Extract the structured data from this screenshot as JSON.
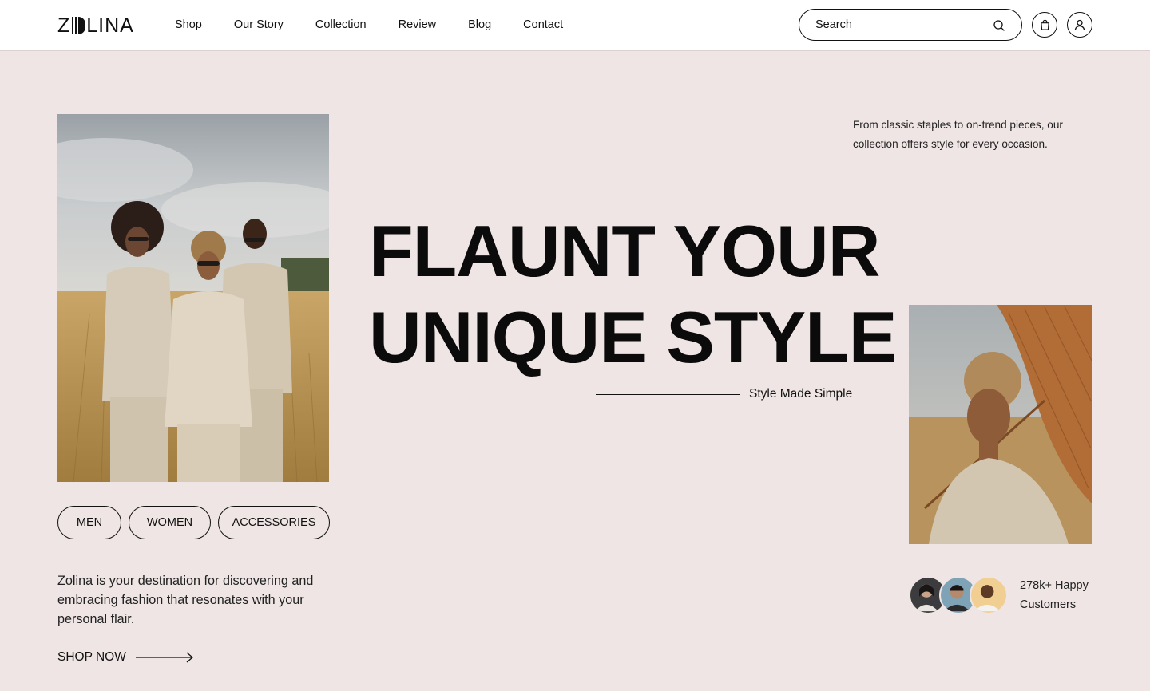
{
  "brand": {
    "logo": "ZOLINA",
    "logo_prefix": "Z",
    "logo_suffix": "LINA"
  },
  "nav": {
    "items": [
      "Shop",
      "Our Story",
      "Collection",
      "Review",
      "Blog",
      "Contact"
    ]
  },
  "search": {
    "placeholder": "Search"
  },
  "hero": {
    "headline_line1": "FLAUNT YOUR",
    "headline_line2": "UNIQUE STYLE",
    "tagline": "Style Made Simple",
    "blurb": "From classic staples to on-trend pieces, our collection offers style for every occasion."
  },
  "categories": [
    "MEN",
    "WOMEN",
    "ACCESSORIES"
  ],
  "intro": {
    "text": "Zolina is your destination for discovering and embracing fashion that resonates with your personal flair.",
    "cta": "SHOP NOW"
  },
  "social_proof": {
    "line1": "278k+ Happy",
    "line2": "Customers"
  },
  "colors": {
    "background": "#eee5e4",
    "header": "#ffffff",
    "text": "#111111"
  },
  "icons": [
    "search-icon",
    "bag-icon",
    "user-icon",
    "arrow-right-icon"
  ]
}
